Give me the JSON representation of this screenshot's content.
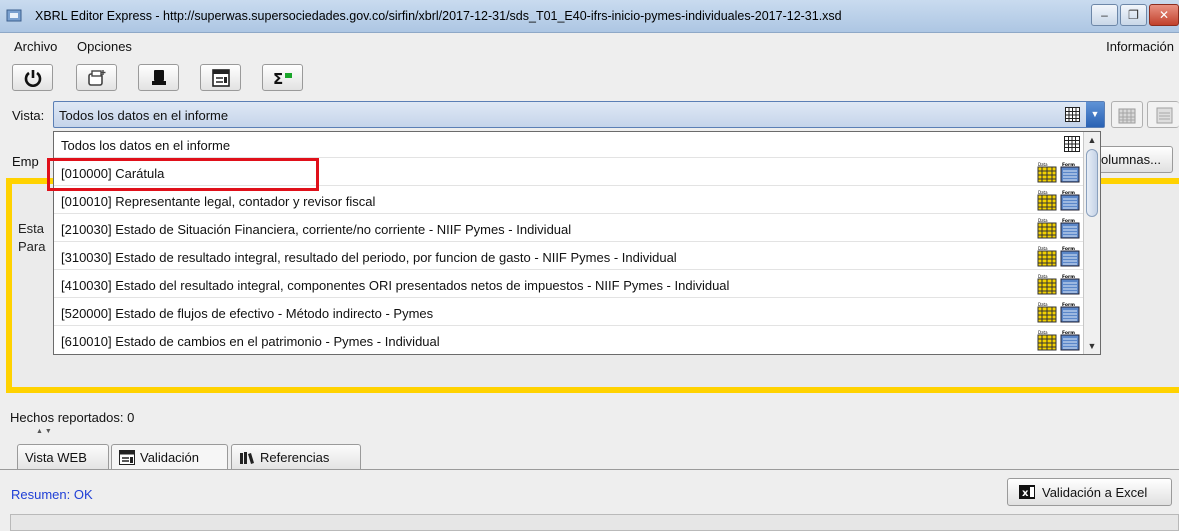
{
  "window": {
    "title": "XBRL Editor Express - http://superwas.supersociedades.gov.co/sirfin/xbrl/2017-12-31/sds_T01_E40-ifrs-inicio-pymes-individuales-2017-12-31.xsd",
    "minimize": "–",
    "maximize": "❐",
    "close": "✕"
  },
  "menubar": {
    "items": [
      "Archivo",
      "Opciones"
    ],
    "info": "Información"
  },
  "toolbar": {
    "buttons": [
      "power-icon",
      "new-document-icon",
      "stamp-icon",
      "form-icon",
      "sigma-icon"
    ]
  },
  "vista": {
    "label": "Vista:",
    "selected": "Todos los datos en el informe",
    "options": [
      "Todos los datos en el informe",
      "[010000] Carátula",
      "[010010] Representante legal, contador y revisor fiscal",
      "[210030] Estado de Situación Financiera, corriente/no corriente - NIIF Pymes - Individual",
      "[310030] Estado de resultado integral, resultado del periodo, por funcion de gasto - NIIF Pymes - Individual",
      "[410030] Estado del resultado integral, componentes ORI presentados netos de impuestos - NIIF Pymes - Individual",
      "[520000] Estado de flujos de efectivo - Método indirecto - Pymes",
      "[610010] Estado de cambios en el patrimonio - Pymes - Individual"
    ],
    "highlighted_option": "[010000] Carátula"
  },
  "empresa": {
    "label": "Emp"
  },
  "columnas": {
    "label": "olumnas..."
  },
  "panel": {
    "line1": "Esta",
    "line2": "Para"
  },
  "hechos": {
    "label": "Hechos reportados: 0"
  },
  "tabs": [
    {
      "label": "Vista WEB",
      "icon": ""
    },
    {
      "label": "Validación",
      "icon": "validation-icon"
    },
    {
      "label": "Referencias",
      "icon": "books-icon"
    }
  ],
  "status": {
    "resumen": "Resumen: OK",
    "excel_button": "Validación a Excel"
  },
  "colors": {
    "highlight": "#e0101a",
    "panel_border": "#ffd200",
    "status_text": "#1f3fd6"
  }
}
